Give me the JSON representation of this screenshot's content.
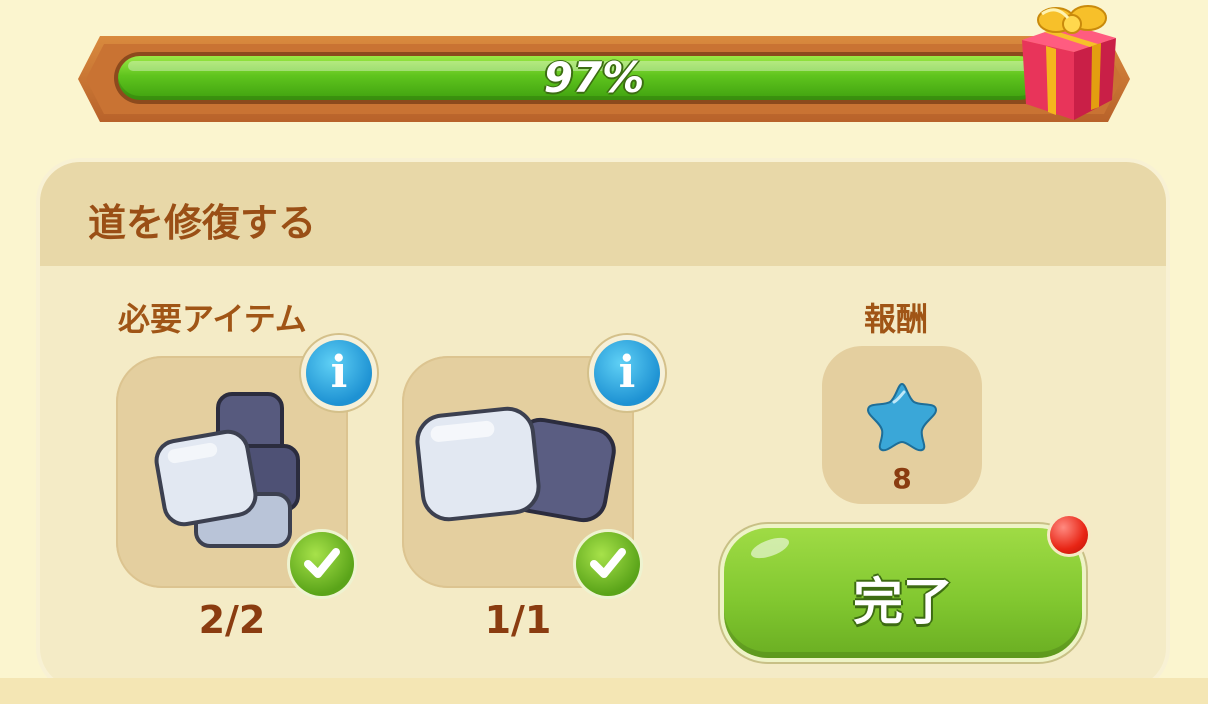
{
  "progress": {
    "percent": 97,
    "label": "97%",
    "reward_icon": "gift-box-icon"
  },
  "task": {
    "title": "道を修復する",
    "required_label": "必要アイテム",
    "reward_label": "報酬",
    "items": [
      {
        "icon": "stone-pile-icon",
        "count": "2/2",
        "complete": true
      },
      {
        "icon": "stone-pair-icon",
        "count": "1/1",
        "complete": true
      }
    ],
    "reward": {
      "icon": "blue-star-icon",
      "amount": "8"
    },
    "complete_button": "完了",
    "notification": true
  },
  "colors": {
    "accent_green": "#82c830",
    "title_brown": "#9a4f16",
    "info_blue": "#1e92d3",
    "notify_red": "#e82515"
  }
}
